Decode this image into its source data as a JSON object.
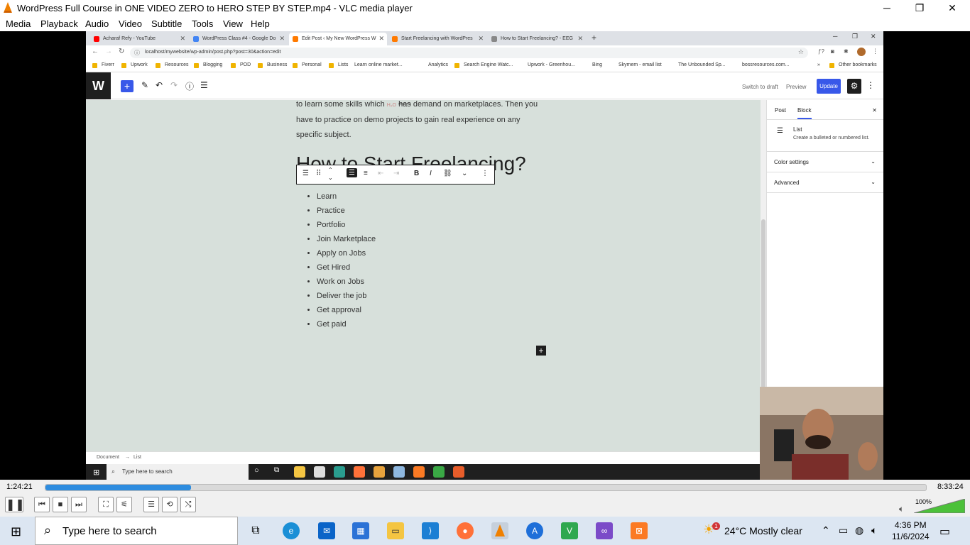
{
  "vlc": {
    "title": "WordPress Full Course in ONE VIDEO  ZERO to HERO  STEP BY STEP.mp4 - VLC media player",
    "menu": [
      "Media",
      "Playback",
      "Audio",
      "Video",
      "Subtitle",
      "Tools",
      "View",
      "Help"
    ],
    "time_current": "1:24:21",
    "time_total": "8:33:24",
    "progress": 0.165,
    "volume": "100%"
  },
  "browser": {
    "tabs": [
      {
        "label": "Acharaf Refy - YouTube",
        "color": "#ff0000"
      },
      {
        "label": "WordPress Class #4 - Google Do",
        "color": "#4285f4"
      },
      {
        "label": "Edit Post ‹ My New WordPress W",
        "color": "#ff7a00"
      },
      {
        "label": "Start Freelancing with WordPres",
        "color": "#ff7a00"
      },
      {
        "label": "How to Start Freelancing? - EEG",
        "color": "#888888"
      }
    ],
    "url": "localhost/mywebsite/wp-admin/post.php?post=30&action=edit",
    "bookmarks": [
      "Fiverr",
      "Upwork",
      "Resources",
      "Blogging",
      "POD",
      "Business",
      "Personal",
      "Lists",
      "Learn online market...",
      "Analytics",
      "Search Engine Watc...",
      "Upwork - Greenhou...",
      "Bing",
      "Skymem - email list",
      "The Unbounded Sp...",
      "bossresources.com...",
      "»",
      "Other bookmarks"
    ]
  },
  "wp": {
    "logo": "W",
    "switch_to_draft": "Switch to draft",
    "preview": "Preview",
    "update": "Update",
    "paragraph_pre": "to learn some skills which ",
    "paragraph_strike": "has",
    "paragraph_post": " demand on marketplaces. Then you have to practice on demo projects to gain real experience on any specific subject.",
    "paragraph_sub": "H₂O",
    "heading": "How to Start Freelancing?",
    "list_items": [
      "Learn",
      "Practice",
      "Portfolio",
      "Join Marketplace",
      "Apply on Jobs",
      "Get Hired",
      "Work on Jobs",
      "Deliver the job",
      "Get approval",
      "Get paid"
    ],
    "sidebar": {
      "tab_post": "Post",
      "tab_block": "Block",
      "block_name": "List",
      "block_desc": "Create a bulleted or numbered list.",
      "panels": [
        "Color settings",
        "Advanced"
      ]
    },
    "footer_doc": "Document",
    "footer_sep": "→",
    "footer_list": "List"
  },
  "inner_taskbar": {
    "search": "Type here to search"
  },
  "taskbar": {
    "search": "Type here to search",
    "weather_temp": "24°C",
    "weather_desc": "Mostly clear",
    "weather_badge": "1",
    "time": "4:36 PM",
    "date": "11/6/2024"
  }
}
